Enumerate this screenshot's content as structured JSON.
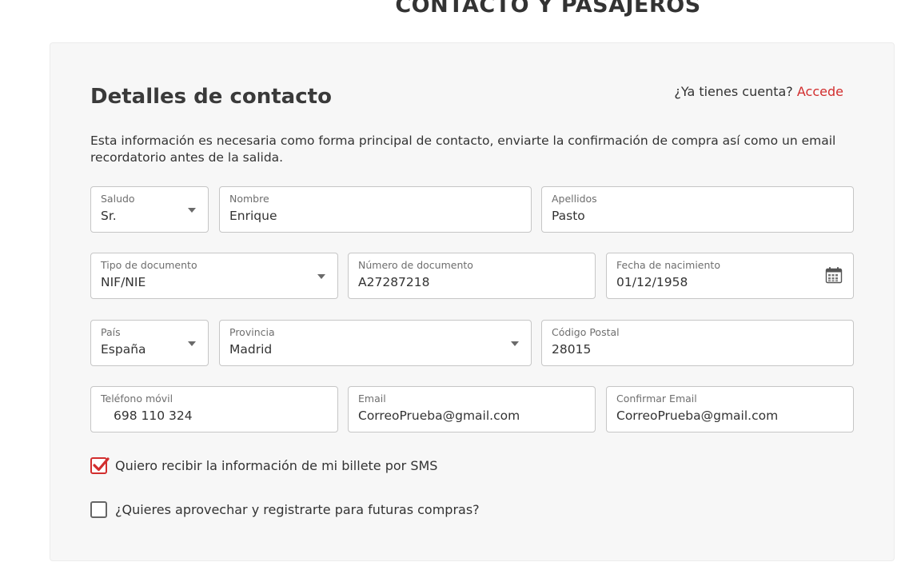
{
  "page": {
    "heading": "CONTACTO Y PASAJEROS"
  },
  "contact": {
    "title": "Detalles de contacto",
    "login_prompt": "¿Ya tienes cuenta?",
    "login_link": "Accede",
    "intro": "Esta información es necesaria como forma principal de contacto, enviarte la confirmación de compra así como un email recordatorio antes de la salida."
  },
  "fields": {
    "salutation": {
      "label": "Saludo",
      "value": "Sr."
    },
    "first_name": {
      "label": "Nombre",
      "value": "Enrique"
    },
    "last_name": {
      "label": "Apellidos",
      "value": "Pasto"
    },
    "document_type": {
      "label": "Tipo de documento",
      "value": "NIF/NIE"
    },
    "document_number": {
      "label": "Número de documento",
      "value": "A27287218"
    },
    "birth_date": {
      "label": "Fecha de nacimiento",
      "value": "01/12/1958",
      "icon": "calendar-icon"
    },
    "country": {
      "label": "País",
      "value": "España"
    },
    "province": {
      "label": "Provincia",
      "value": "Madrid"
    },
    "postal_code": {
      "label": "Código Postal",
      "value": "28015"
    },
    "mobile": {
      "label": "Teléfono móvil",
      "value": "698 110 324"
    },
    "email": {
      "label": "Email",
      "value": "CorreoPrueba@gmail.com"
    },
    "confirm_email": {
      "label": "Confirmar Email",
      "value": "CorreoPrueba@gmail.com"
    }
  },
  "options": {
    "sms": {
      "label": "Quiero recibir la información de mi billete por SMS",
      "checked": true
    },
    "register": {
      "label": "¿Quieres aprovechar y registrarte para futuras compras?",
      "checked": false
    }
  },
  "colors": {
    "accent": "#d22e2e",
    "card_background": "#f7f7f7",
    "field_border": "#c6c6c6"
  }
}
